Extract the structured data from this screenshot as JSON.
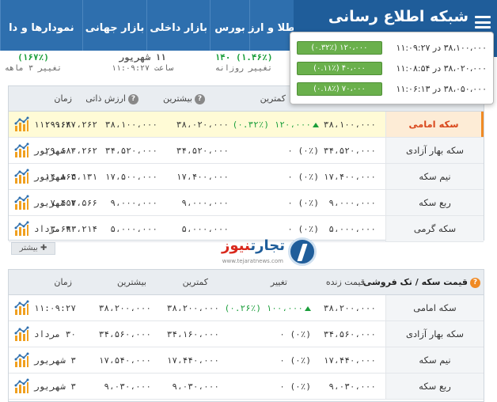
{
  "nav": {
    "brand": "شبکه اطلاع رسانی",
    "items": [
      "طلا و ارز",
      "بورس",
      "بازار داخلی",
      "بازار جهانی",
      "نمودارها و دا"
    ]
  },
  "substrip": {
    "c1_val": "(۱.۴۶٪) ۱۴۰",
    "c1_label": "تغییر روزانه",
    "c2_val": "۱۱ شهریور",
    "c2_label": "ساعت ۱۱:۰۹:۲۷",
    "c3_val": "(۱۶۷٪)",
    "c3_label": "تغییر ۳ ماهه"
  },
  "popup": {
    "rows": [
      {
        "text": "۳۸،۱۰۰،۰۰۰ در ۱۱:۰۹:۲۷",
        "badge": "۱۲۰،۰۰۰ (۰.۳۲٪)"
      },
      {
        "text": "۳۸،۰۲۰،۰۰۰ در ۱۱:۰۸:۵۴",
        "badge": "۴۰،۰۰۰ (۰.۱۱٪)"
      },
      {
        "text": "۳۸،۰۵۰،۰۰۰ در ۱۱:۰۶:۱۳",
        "badge": "۷۰،۰۰۰ (۰.۱۸٪)"
      }
    ]
  },
  "table1": {
    "headers": {
      "low": "کمترین",
      "high": "بیشترین",
      "intrinsic": "ارزش ذاتی",
      "time": "زمان"
    },
    "rows": [
      {
        "name": "سکه امامی",
        "price": "۳۸،۱۰۰،۰۰۰",
        "change": "۱۲۰،۰۰۰ (۰.۳۲٪)",
        "low": "۳۸،۰۲۰،۰۰۰",
        "high": "۳۸،۱۰۰،۰۰۰",
        "intrinsic": "۲۹،۶۸۰،۲۶۲",
        "time": "۱۱:۰۹:۲۷"
      },
      {
        "name": "سکه بهار آزادی",
        "price": "۳۴،۵۲۰،۰۰۰",
        "change": "(۰٪) ۰",
        "low": "۳۴،۵۲۰،۰۰۰",
        "high": "۳۴،۵۲۰،۰۰۰",
        "intrinsic": "۲۹،۶۸۰،۲۶۲",
        "time": "۳ شهریور"
      },
      {
        "name": "نیم سکه",
        "price": "۱۷،۴۰۰،۰۰۰",
        "change": "(۰٪) ۰",
        "low": "۱۷،۴۰۰،۰۰۰",
        "high": "۱۷،۵۰۰،۰۰۰",
        "intrinsic": "۱۴،۸۶۵،۱۳۱",
        "time": "۳ شهریور"
      },
      {
        "name": "ربع سکه",
        "price": "۹،۰۰۰،۰۰۰",
        "change": "(۰٪) ۰",
        "low": "۹،۰۰۰،۰۰۰",
        "high": "۹،۰۰۰،۰۰۰",
        "intrinsic": "۷،۴۵۷،۵۶۶",
        "time": "۳ شهریور"
      },
      {
        "name": "سکه گرمی",
        "price": "۵،۰۰۰،۰۰۰",
        "change": "(۰٪) ۰",
        "low": "۵،۰۰۰،۰۰۰",
        "high": "۵،۰۰۰،۰۰۰",
        "intrinsic": "۳،۶۹۳،۲۱۴",
        "time": "۳۰ مرداد"
      }
    ],
    "more_label": "بیشتر"
  },
  "logo": {
    "text_blue": "تجارت",
    "text_red": "نیوز",
    "url": "www.tejaratnews.com"
  },
  "table2": {
    "headers": {
      "title": "قیمت سکه / تک فروشی",
      "live": "قیمت زنده",
      "change": "تغییر",
      "low": "کمترین",
      "high": "بیشترین",
      "time": "زمان"
    },
    "rows": [
      {
        "name": "سکه امامی",
        "price": "۳۸،۲۰۰،۰۰۰",
        "change": "۱۰۰،۰۰۰ (۰.۲۶٪)",
        "low": "۳۸،۲۰۰،۰۰۰",
        "high": "۳۸،۲۰۰،۰۰۰",
        "time": "۱۱:۰۹:۲۷"
      },
      {
        "name": "سکه بهار آزادی",
        "price": "۳۴،۵۶۰،۰۰۰",
        "change": "(۰٪) ۰",
        "low": "۳۴،۱۶۰،۰۰۰",
        "high": "۳۴،۵۶۰،۰۰۰",
        "time": "۳۰ مرداد"
      },
      {
        "name": "نیم سکه",
        "price": "۱۷،۴۴۰،۰۰۰",
        "change": "(۰٪) ۰",
        "low": "۱۷،۴۴۰،۰۰۰",
        "high": "۱۷،۵۴۰،۰۰۰",
        "time": "۳ شهریور"
      },
      {
        "name": "ربع سکه",
        "price": "۹،۰۳۰،۰۰۰",
        "change": "(۰٪) ۰",
        "low": "۹،۰۳۰،۰۰۰",
        "high": "۹،۰۳۰،۰۰۰",
        "time": "۳ شهریور"
      }
    ]
  },
  "colors": {
    "nav": "#2e6fae",
    "brand": "#1f5d9a",
    "accent": "#f08a24",
    "up": "#1a9e3a",
    "badge": "#6ab04c"
  }
}
